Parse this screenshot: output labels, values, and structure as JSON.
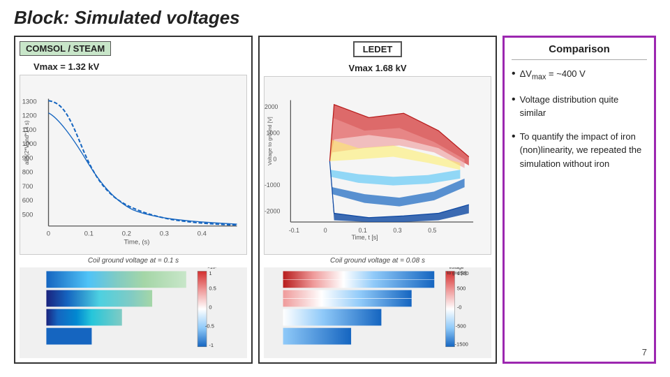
{
  "page": {
    "title": "Block: Simulated voltages",
    "page_number": "7"
  },
  "left_panel": {
    "badge_label": "COMSOL / STEAM",
    "vmax_label": "Vmax = 1.32 kV",
    "coil_label": "Coil ground voltage at = 0.1 s"
  },
  "middle_panel": {
    "badge_label": "LEDET",
    "vmax_label": "Vmax 1.68 kV",
    "coil_label": "Coil ground voltage at = 0.08 s"
  },
  "right_panel": {
    "title": "Comparison",
    "bullets": [
      {
        "text": "ΔVmax = ~400 V"
      },
      {
        "text": "Voltage distribution quite similar"
      },
      {
        "text": "To quantify the impact of iron (non)linearity, we repeated the simulation without iron"
      }
    ]
  }
}
